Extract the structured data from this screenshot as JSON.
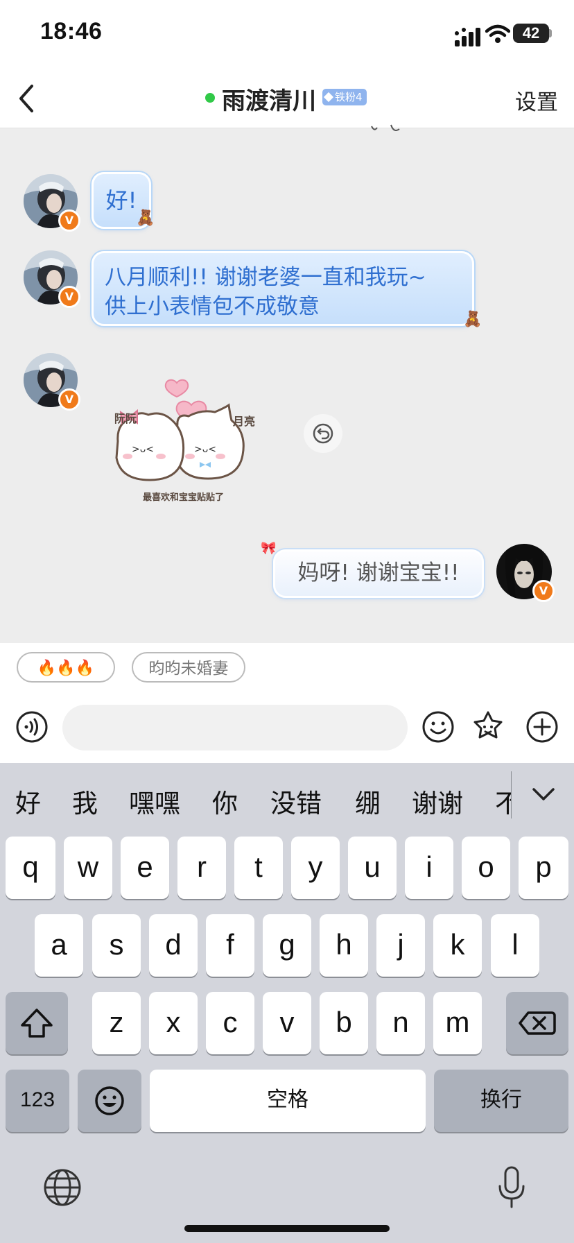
{
  "status_bar": {
    "time": "18:46",
    "battery": "42"
  },
  "header": {
    "title": "雨渡清川",
    "fan_badge": "铁粉4",
    "settings": "设置"
  },
  "messages": [
    {
      "side": "in",
      "text": "好!"
    },
    {
      "side": "in",
      "text_line1": "八月顺利!! 谢谢老婆一直和我玩~",
      "text_line2": "供上小表情包不成敬意"
    },
    {
      "side": "in",
      "type": "sticker",
      "left_name": "阮阮",
      "right_name": "月亮",
      "caption": "最喜欢和宝宝贴贴了"
    },
    {
      "side": "out",
      "text": "妈呀! 谢谢宝宝!!"
    }
  ],
  "badges": {
    "verified": "V"
  },
  "quick_replies": [
    "🔥🔥🔥",
    "昀昀未婚妻"
  ],
  "keyboard": {
    "suggestions": [
      "好",
      "我",
      "嘿嘿",
      "你",
      "没错",
      "绷",
      "谢谢",
      "不"
    ],
    "row1": [
      "q",
      "w",
      "e",
      "r",
      "t",
      "y",
      "u",
      "i",
      "o",
      "p"
    ],
    "row2": [
      "a",
      "s",
      "d",
      "f",
      "g",
      "h",
      "j",
      "k",
      "l"
    ],
    "row3": [
      "z",
      "x",
      "c",
      "v",
      "b",
      "n",
      "m"
    ],
    "numbers_key": "123",
    "space_key": "空格",
    "return_key": "换行"
  },
  "colors": {
    "accent_bubble_text": "#2f6fd0",
    "online": "#31c948",
    "badge": "#f07a1a"
  }
}
